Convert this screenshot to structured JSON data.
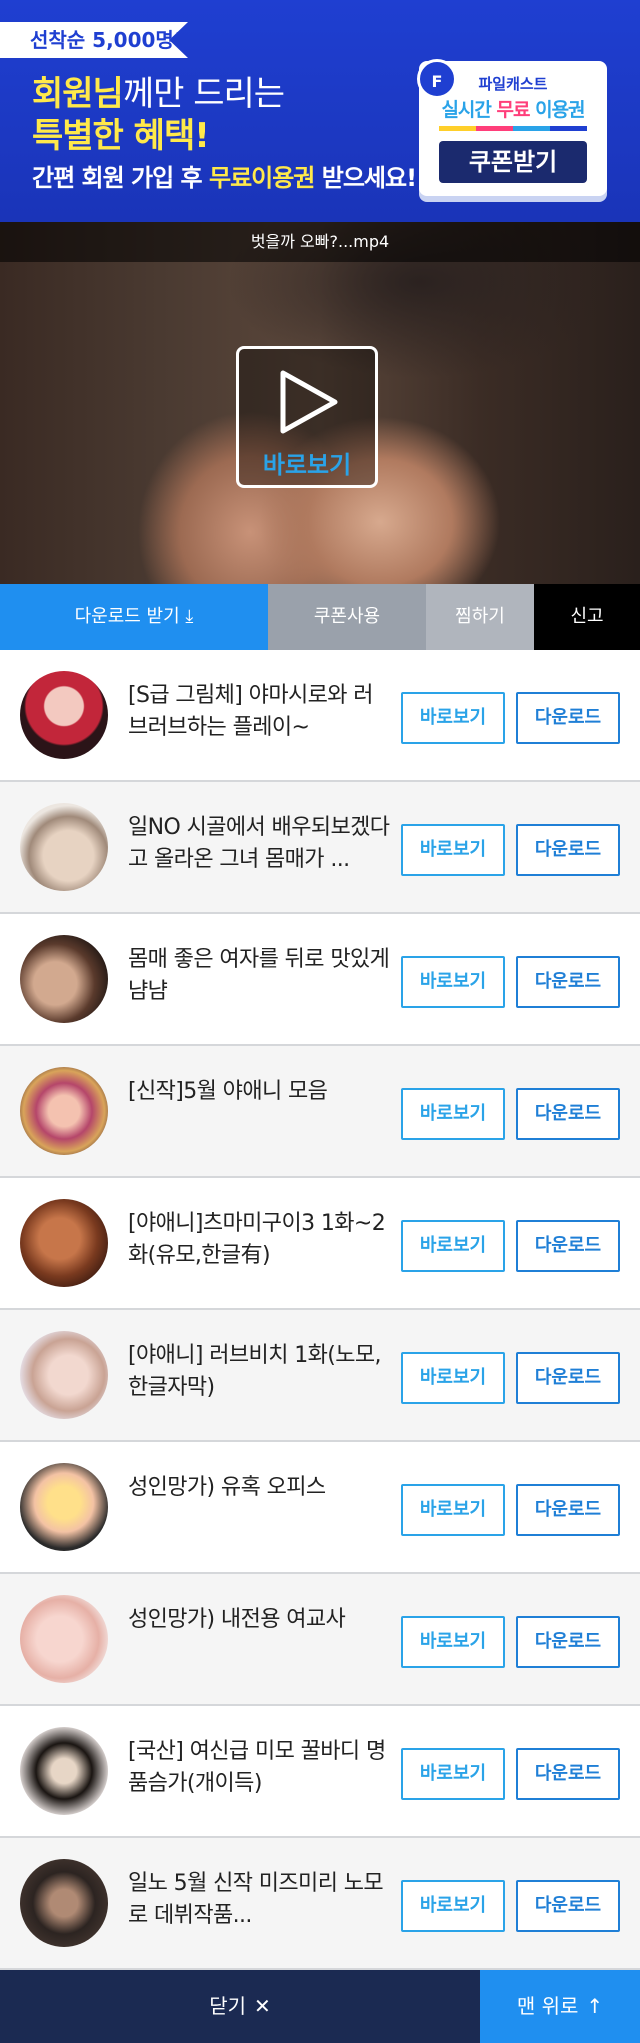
{
  "banner": {
    "badge": "선착순 5,000명!",
    "line1_strong": "회원님",
    "line1_rest": "께만 드리는",
    "line2": "특별한 혜택!",
    "line3_a": "간편 회원 가입 후 ",
    "line3_highlight": "무료이용권",
    "line3_b": " 받으세요!",
    "card_logo": "F",
    "card_brand": "파일캐스트",
    "card_pass_a": "실시간 ",
    "card_pass_red": "무료",
    "card_pass_b": " 이용권",
    "card_button": "쿠폰받기"
  },
  "video": {
    "filename": "벗을까 오빠?...mp4",
    "play_label": "바로보기"
  },
  "actions": {
    "download": "다운로드 받기",
    "download_icon": "⤓",
    "coupon": "쿠폰사용",
    "like": "찜하기",
    "report": "신고"
  },
  "list": {
    "watch_label": "바로보기",
    "download_label": "다운로드",
    "items": [
      {
        "title": "[S급 그림체] 야마시로와 러브러브하는 플레이~"
      },
      {
        "title": "일NO 시골에서 배우되보겠다고 올라온 그녀 몸매가 ..."
      },
      {
        "title": "몸매 좋은 여자를 뒤로 맛있게 냠냠"
      },
      {
        "title": "[신작]5월 야애니 모음"
      },
      {
        "title": "[야애니]츠마미구이3 1화~2화(유모,한글有)"
      },
      {
        "title": "[야애니] 러브비치 1화(노모,한글자막)"
      },
      {
        "title": "성인망가) 유혹 오피스"
      },
      {
        "title": "성인망가) 내전용 여교사"
      },
      {
        "title": "[국산] 여신급 미모 꿀바디 명품슴가(개이득)"
      },
      {
        "title": "일노 5월 신작 미즈미리 노모로 데뷔작품..."
      }
    ]
  },
  "bottom": {
    "close": "닫기",
    "close_icon": "✕",
    "top": "맨 위로",
    "top_icon": "↑"
  },
  "colors": {
    "banner_blue": "#1f3fd1",
    "accent_blue": "#1f8ff0",
    "button_cyan": "#2aa3e8",
    "highlight_yellow": "#ffe94a",
    "navy": "#1b2a52"
  }
}
